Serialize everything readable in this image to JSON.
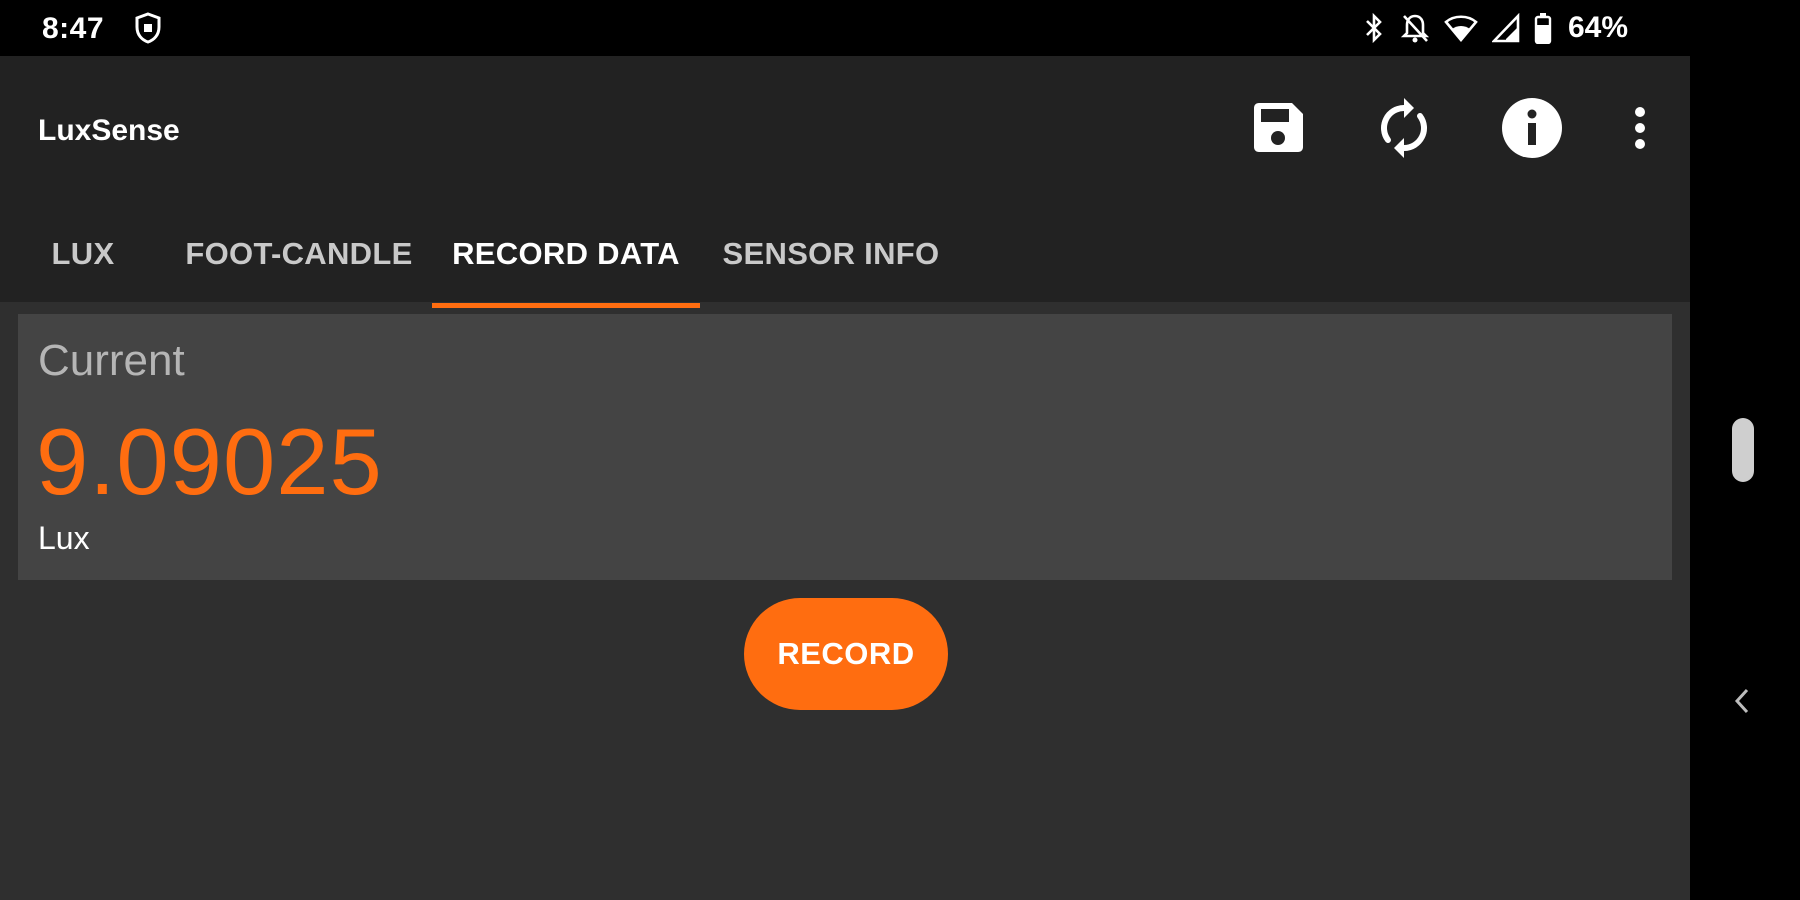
{
  "status_bar": {
    "time": "8:47",
    "left_icon": "shield-icon",
    "right_icons": [
      "bluetooth-icon",
      "notifications-off-icon",
      "wifi-icon",
      "signal-icon",
      "battery-icon"
    ],
    "battery_percent": "64%"
  },
  "toolbar": {
    "title": "LuxSense",
    "actions": [
      {
        "name": "save-icon"
      },
      {
        "name": "refresh-icon"
      },
      {
        "name": "info-icon"
      },
      {
        "name": "more-vert-icon"
      }
    ]
  },
  "tabs": [
    {
      "label": "LUX",
      "active": false
    },
    {
      "label": "FOOT-CANDLE",
      "active": false
    },
    {
      "label": "RECORD DATA",
      "active": true
    },
    {
      "label": "SENSOR INFO",
      "active": false
    }
  ],
  "reading": {
    "label": "Current",
    "value": "9.09025",
    "unit": "Lux"
  },
  "record_button": {
    "label": "RECORD"
  },
  "colors": {
    "accent": "#ff6d10",
    "toolbar": "#222222",
    "background": "#2f2f2f",
    "card": "#444444"
  }
}
